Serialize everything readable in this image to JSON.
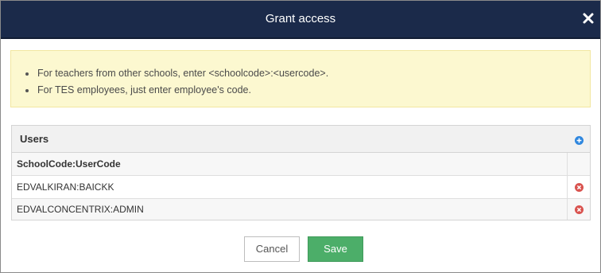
{
  "dialog": {
    "title": "Grant access",
    "close_icon": "close-icon",
    "colors": {
      "titlebar": "#1b2a4a",
      "notice_bg": "#fcf8d0",
      "save": "#4cae69",
      "add_icon": "#2e86de",
      "remove_icon": "#d9534f"
    }
  },
  "notice": {
    "items": [
      "For teachers from other schools, enter <schoolcode>:<usercode>.",
      "For TES employees, just enter employee's code."
    ]
  },
  "users_panel": {
    "title": "Users",
    "add_icon": "plus-circle-icon",
    "column_header": "SchoolCode:UserCode",
    "rows": [
      {
        "value": "EDVALKIRAN:BAICKK",
        "remove_icon": "remove-circle-icon"
      },
      {
        "value": "EDVALCONCENTRIX:ADMIN",
        "remove_icon": "remove-circle-icon"
      }
    ]
  },
  "footer": {
    "cancel_label": "Cancel",
    "save_label": "Save"
  }
}
